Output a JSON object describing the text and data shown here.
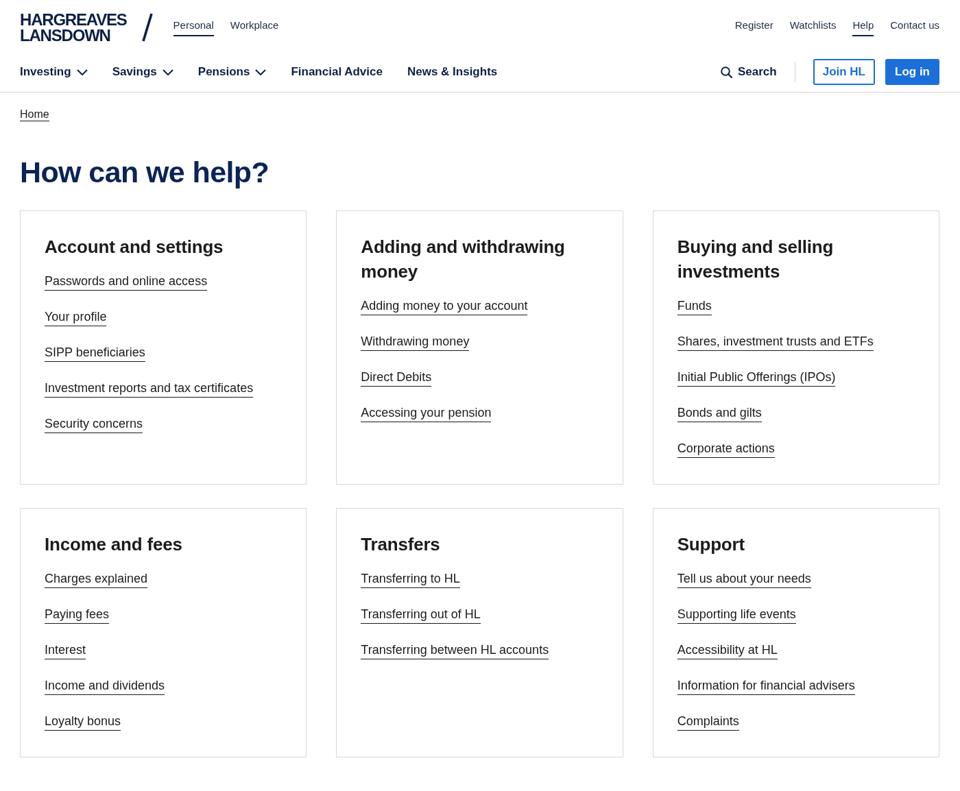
{
  "logo": {
    "lines": [
      "HARGREAVES",
      "LANSDOWN"
    ]
  },
  "segments": [
    {
      "label": "Personal",
      "selected": true
    },
    {
      "label": "Workplace",
      "selected": false
    }
  ],
  "utility_links": [
    {
      "label": "Register",
      "selected": false
    },
    {
      "label": "Watchlists",
      "selected": false
    },
    {
      "label": "Help",
      "selected": true
    },
    {
      "label": "Contact us",
      "selected": false
    }
  ],
  "main_nav": [
    {
      "label": "Investing",
      "dropdown": true
    },
    {
      "label": "Savings",
      "dropdown": true
    },
    {
      "label": "Pensions",
      "dropdown": true
    },
    {
      "label": "Financial Advice",
      "dropdown": false
    },
    {
      "label": "News & Insights",
      "dropdown": false
    }
  ],
  "search": {
    "label": "Search"
  },
  "buttons": [
    {
      "label": "Join HL",
      "kind": "outline"
    },
    {
      "label": "Log in",
      "kind": "primary"
    }
  ],
  "breadcrumb": [
    {
      "label": "Home"
    }
  ],
  "heading": "How can we help?",
  "topics": [
    {
      "title": "Account and settings",
      "links": [
        "Passwords and online access",
        "Your profile",
        "SIPP beneficiaries",
        "Investment reports and tax certificates",
        "Security concerns"
      ]
    },
    {
      "title": "Adding and withdrawing money",
      "links": [
        "Adding money to your account",
        "Withdrawing money",
        "Direct Debits",
        "Accessing your pension"
      ]
    },
    {
      "title": "Buying and selling investments",
      "links": [
        "Funds",
        "Shares, investment trusts and ETFs",
        "Initial Public Offerings (IPOs)",
        "Bonds and gilts",
        "Corporate actions"
      ]
    },
    {
      "title": "Income and fees",
      "links": [
        "Charges explained",
        "Paying fees",
        "Interest",
        "Income and dividends",
        "Loyalty bonus"
      ]
    },
    {
      "title": "Transfers",
      "links": [
        "Transferring to HL",
        "Transferring out of HL",
        "Transferring between HL accounts"
      ]
    },
    {
      "title": "Support",
      "links": [
        "Tell us about your needs",
        "Supporting life events",
        "Accessibility at HL",
        "Information for financial advisers",
        "Complaints"
      ]
    }
  ]
}
